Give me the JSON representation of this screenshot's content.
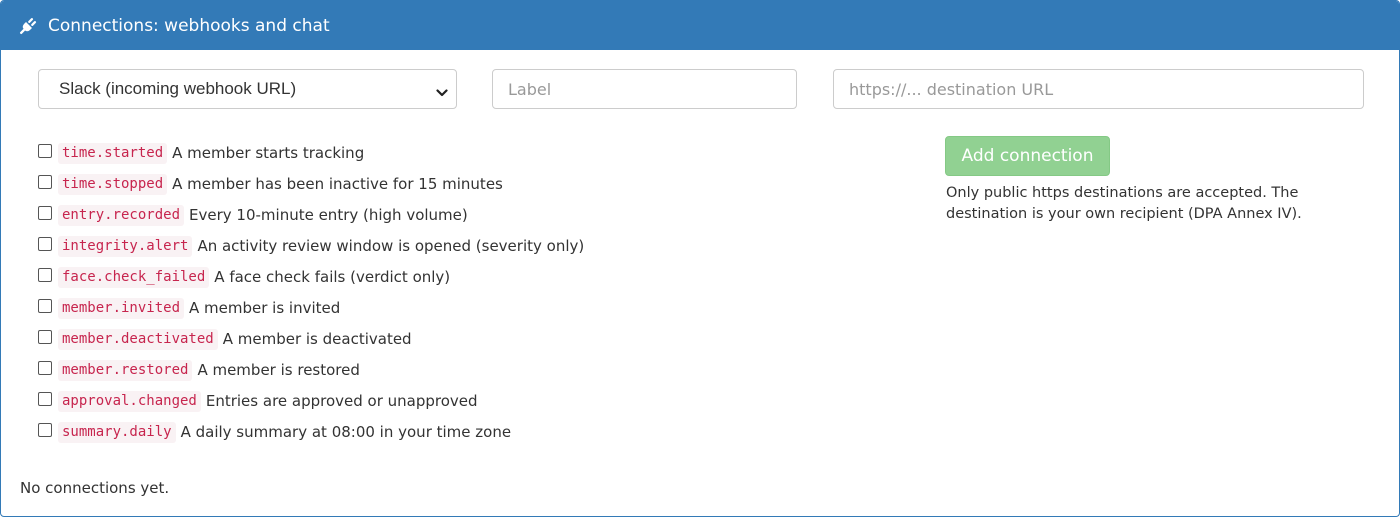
{
  "panel": {
    "title": "Connections: webhooks and chat",
    "icon": "plug-icon",
    "header_color": "#337ab7"
  },
  "form": {
    "destination_type_selected": "Slack (incoming webhook URL)",
    "label_placeholder": "Label",
    "url_placeholder": "https://... destination URL",
    "add_button_label": "Add connection",
    "help_text": "Only public https destinations are accepted. The destination is your own recipient (DPA Annex IV)."
  },
  "events": [
    {
      "code": "time.started",
      "description": "A member starts tracking",
      "checked": false
    },
    {
      "code": "time.stopped",
      "description": "A member has been inactive for 15 minutes",
      "checked": false
    },
    {
      "code": "entry.recorded",
      "description": "Every 10-minute entry (high volume)",
      "checked": false
    },
    {
      "code": "integrity.alert",
      "description": "An activity review window is opened (severity only)",
      "checked": false
    },
    {
      "code": "face.check_failed",
      "description": "A face check fails (verdict only)",
      "checked": false
    },
    {
      "code": "member.invited",
      "description": "A member is invited",
      "checked": false
    },
    {
      "code": "member.deactivated",
      "description": "A member is deactivated",
      "checked": false
    },
    {
      "code": "member.restored",
      "description": "A member is restored",
      "checked": false
    },
    {
      "code": "approval.changed",
      "description": "Entries are approved or unapproved",
      "checked": false
    },
    {
      "code": "summary.daily",
      "description": "A daily summary at 08:00 in your time zone",
      "checked": false
    }
  ],
  "connections": {
    "empty_text": "No connections yet."
  }
}
